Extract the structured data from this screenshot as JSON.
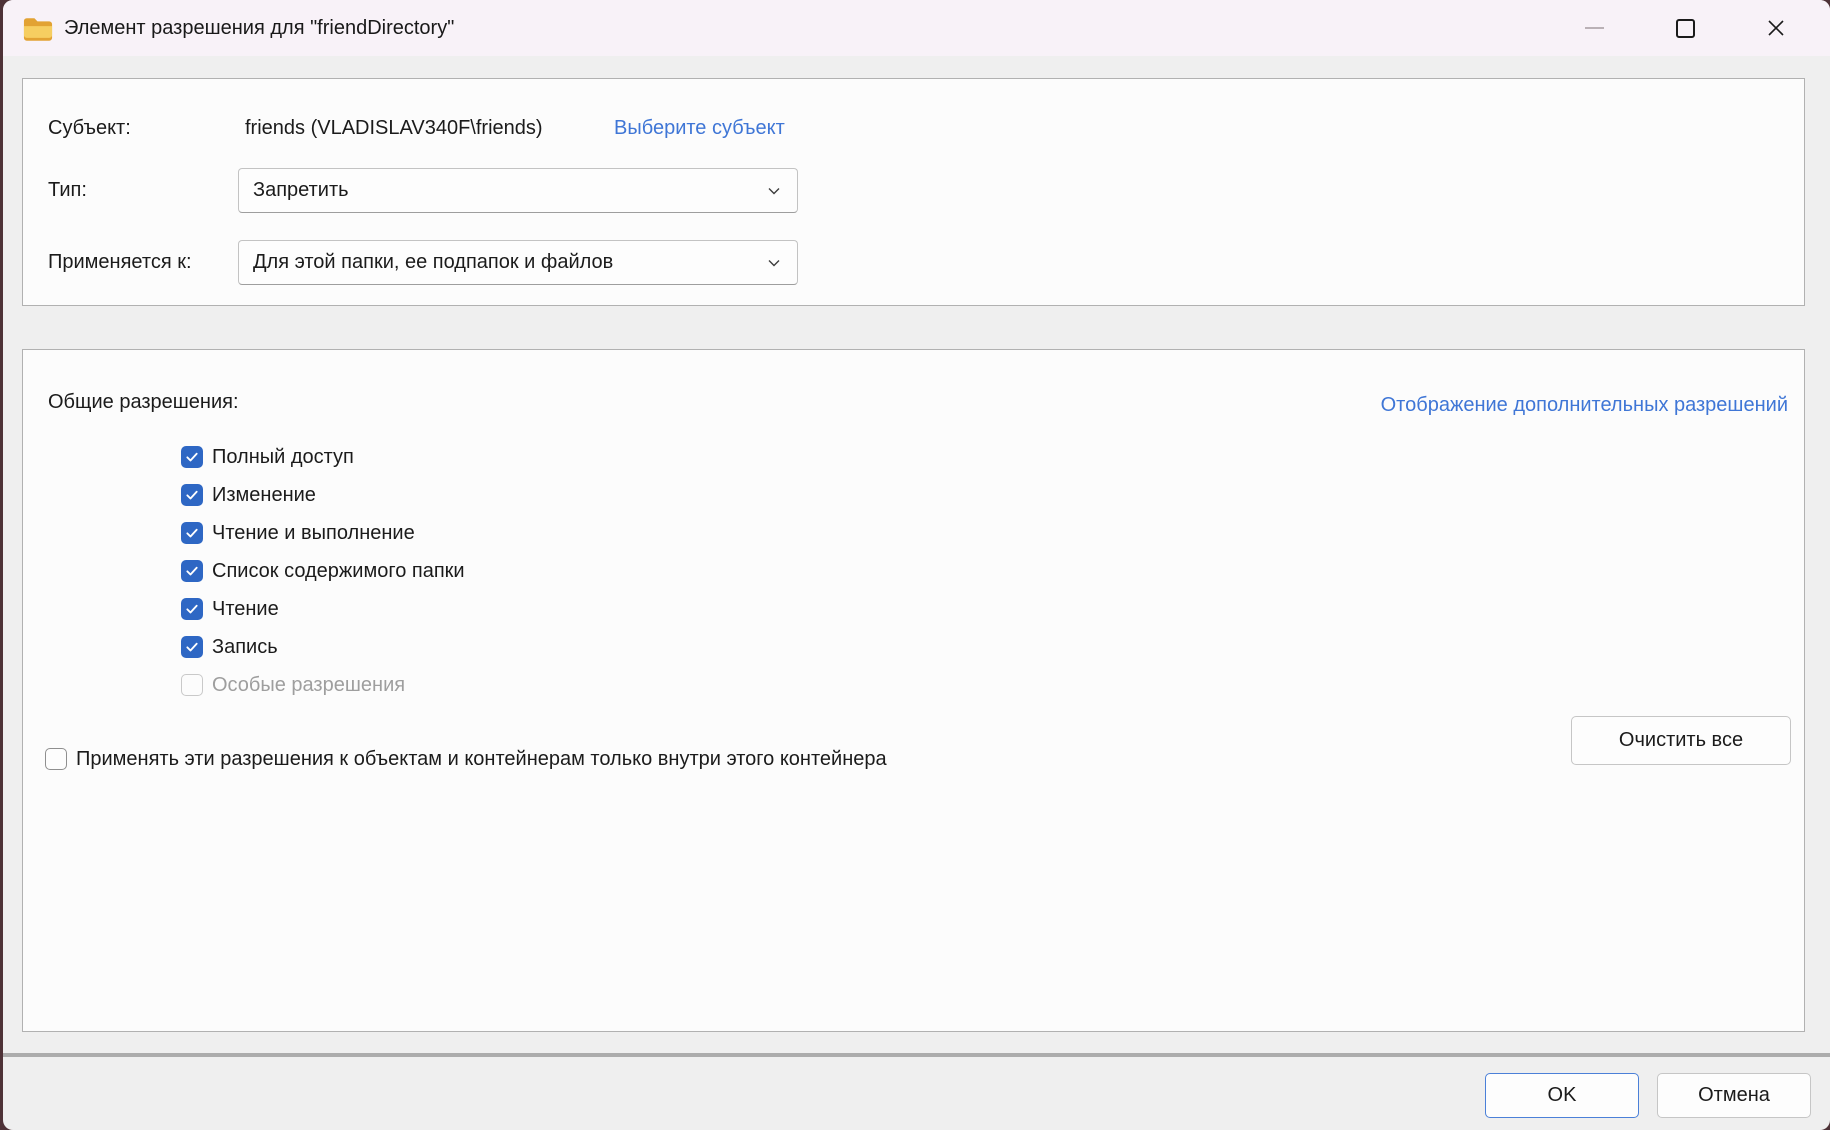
{
  "window": {
    "title": "Элемент разрешения для \"friendDirectory\""
  },
  "principal": {
    "subject_label": "Субъект:",
    "subject_value": "friends (VLADISLAV340F\\friends)",
    "select_subject_link": "Выберите субъект",
    "type_label": "Тип:",
    "type_value": "Запретить",
    "applies_to_label": "Применяется к:",
    "applies_to_value": "Для этой папки, ее подпапок и файлов"
  },
  "permissions": {
    "header_label": "Общие разрешения:",
    "advanced_link": "Отображение дополнительных разрешений",
    "items": [
      {
        "label": "Полный доступ",
        "checked": true,
        "disabled": false
      },
      {
        "label": "Изменение",
        "checked": true,
        "disabled": false
      },
      {
        "label": "Чтение и выполнение",
        "checked": true,
        "disabled": false
      },
      {
        "label": "Список содержимого папки",
        "checked": true,
        "disabled": false
      },
      {
        "label": "Чтение",
        "checked": true,
        "disabled": false
      },
      {
        "label": "Запись",
        "checked": true,
        "disabled": false
      },
      {
        "label": "Особые разрешения",
        "checked": false,
        "disabled": true
      }
    ],
    "apply_only": {
      "label": "Применять эти разрешения к объектам и контейнерам только внутри этого контейнера",
      "checked": false,
      "disabled": false
    },
    "clear_all_button": "Очистить все"
  },
  "footer": {
    "ok_button": "OK",
    "cancel_button": "Отмена"
  },
  "colors": {
    "accent_checkbox": "#2e67c4",
    "link": "#3f76d6",
    "ok_border": "#4b80d8",
    "titlebar_bg": "#f8f2f8",
    "dialog_bg": "#efefef"
  }
}
